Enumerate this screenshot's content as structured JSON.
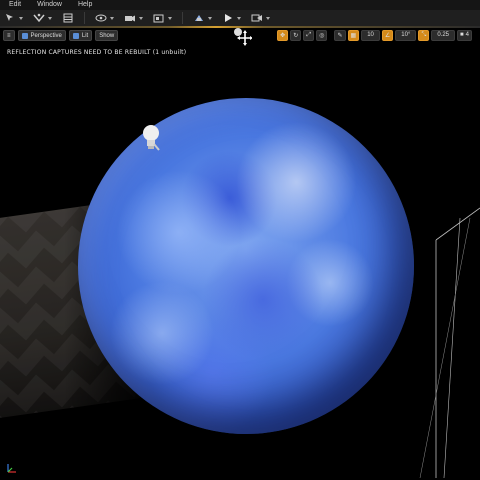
{
  "menu": {
    "items": [
      "Edit",
      "Window",
      "Help"
    ]
  },
  "toolbar": {
    "tools": [
      "select-tool-icon",
      "transform-tool-icon",
      "content-icon",
      "blueprint-icon",
      "cinematics-icon",
      "build-icon",
      "platforms-icon",
      "play-icon",
      "launch-icon"
    ]
  },
  "viewport_toolbar": {
    "left": {
      "perspective_label": "Perspective",
      "lit_label": "Lit",
      "show_label": "Show"
    },
    "right": {
      "grid_snap_value": "10",
      "rotation_snap_value": "10°",
      "scale_snap_value": "0.25",
      "camera_speed_value": "4"
    },
    "accent_color": "#d48a1a"
  },
  "viewport": {
    "warning_text": "REFLECTION CAPTURES NEED TO BE REBUILT (1 unbuilt)"
  },
  "colors": {
    "sphere": "#4a78e0",
    "background": "#000000",
    "toolbar": "#1f1f1f"
  }
}
